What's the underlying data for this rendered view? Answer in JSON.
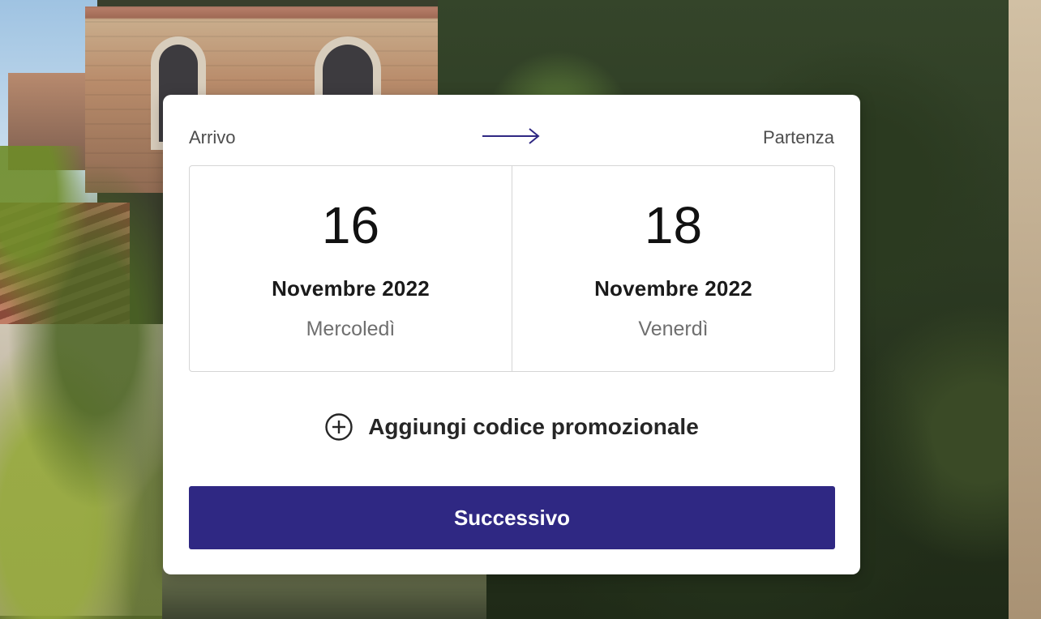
{
  "booking": {
    "arrival_label": "Arrivo",
    "departure_label": "Partenza",
    "checkin": {
      "day": "16",
      "month_year": "Novembre 2022",
      "weekday": "Mercoledì"
    },
    "checkout": {
      "day": "18",
      "month_year": "Novembre 2022",
      "weekday": "Venerdì"
    },
    "promo_label": "Aggiungi codice promozionale",
    "promo_icon": "plus-circle-icon",
    "arrow_icon": "arrow-right-icon",
    "next_button": "Successivo"
  },
  "colors": {
    "primary": "#2f2883",
    "card_bg": "#ffffff",
    "border": "#d5d5d5"
  }
}
